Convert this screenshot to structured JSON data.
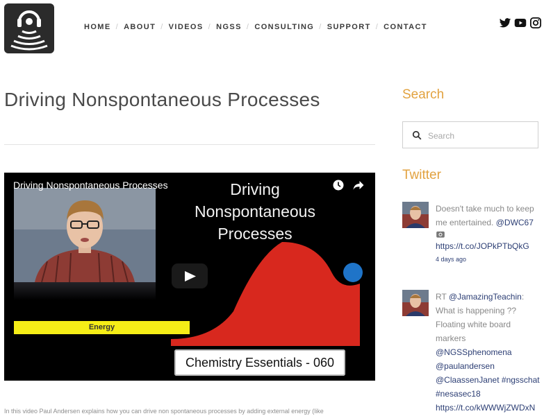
{
  "nav": {
    "items": [
      {
        "label": "HOME"
      },
      {
        "label": "ABOUT"
      },
      {
        "label": "VIDEOS"
      },
      {
        "label": "NGSS"
      },
      {
        "label": "CONSULTING"
      },
      {
        "label": "SUPPORT"
      },
      {
        "label": "CONTACT"
      }
    ]
  },
  "social": [
    "twitter-icon",
    "youtube-icon",
    "instagram-icon"
  ],
  "page": {
    "title": "Driving Nonspontaneous Processes",
    "description": "In this video Paul Andersen explains how you can drive non spontaneous processes by adding external energy (like"
  },
  "video": {
    "title": "Driving Nonspontaneous Processes",
    "slide_title_line1": "Driving",
    "slide_title_line2": "Nonspontaneous",
    "slide_title_line3": "Processes",
    "energy_label": "Energy",
    "caption": "Chemistry Essentials - 060"
  },
  "sidebar": {
    "search_title": "Search",
    "search_placeholder": "Search",
    "twitter_title": "Twitter",
    "tweets": [
      {
        "text": "Doesn't take much to keep me entertained. ",
        "mention": "@DWC67",
        "link": "https://t.co/JOPkPTbQkG",
        "time": "4 days ago"
      },
      {
        "prefix": "RT ",
        "mention": "@JamazingTeachin",
        "text": ": What is happening ?? Floating white board markers ",
        "mention2": "@NGSSphenomena",
        "mention3": "@paulandersen",
        "mention4": "@ClaassenJanet",
        "hashtags": " #ngsschat #nesasec18",
        "link": "https://t.co/kWWWjZWDxN"
      }
    ]
  },
  "colors": {
    "accent": "#e2a23f",
    "link": "#2c3e74"
  }
}
